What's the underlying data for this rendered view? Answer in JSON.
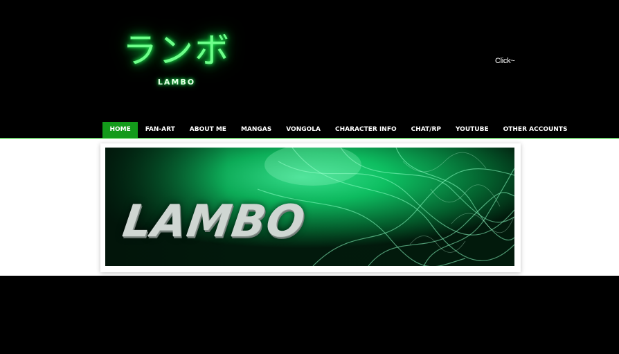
{
  "header": {
    "logo_jp": "ランボ",
    "logo_en": "LAMBO",
    "click_label": "Click~"
  },
  "nav": {
    "items": [
      {
        "label": "HOME",
        "active": true
      },
      {
        "label": "FAN-ART"
      },
      {
        "label": "ABOUT ME"
      },
      {
        "label": "MANGAS"
      },
      {
        "label": "VONGOLA"
      },
      {
        "label": "CHARACTER INFO"
      },
      {
        "label": "CHAT/RP"
      },
      {
        "label": "YOUTUBE"
      },
      {
        "label": "OTHER ACCOUNTS"
      }
    ]
  },
  "banner": {
    "text": "LAMBO"
  },
  "colors": {
    "background": "#000000",
    "nav_active": "#139a1a",
    "neon_green": "#22ff55",
    "content_bg": "#ffffff"
  }
}
